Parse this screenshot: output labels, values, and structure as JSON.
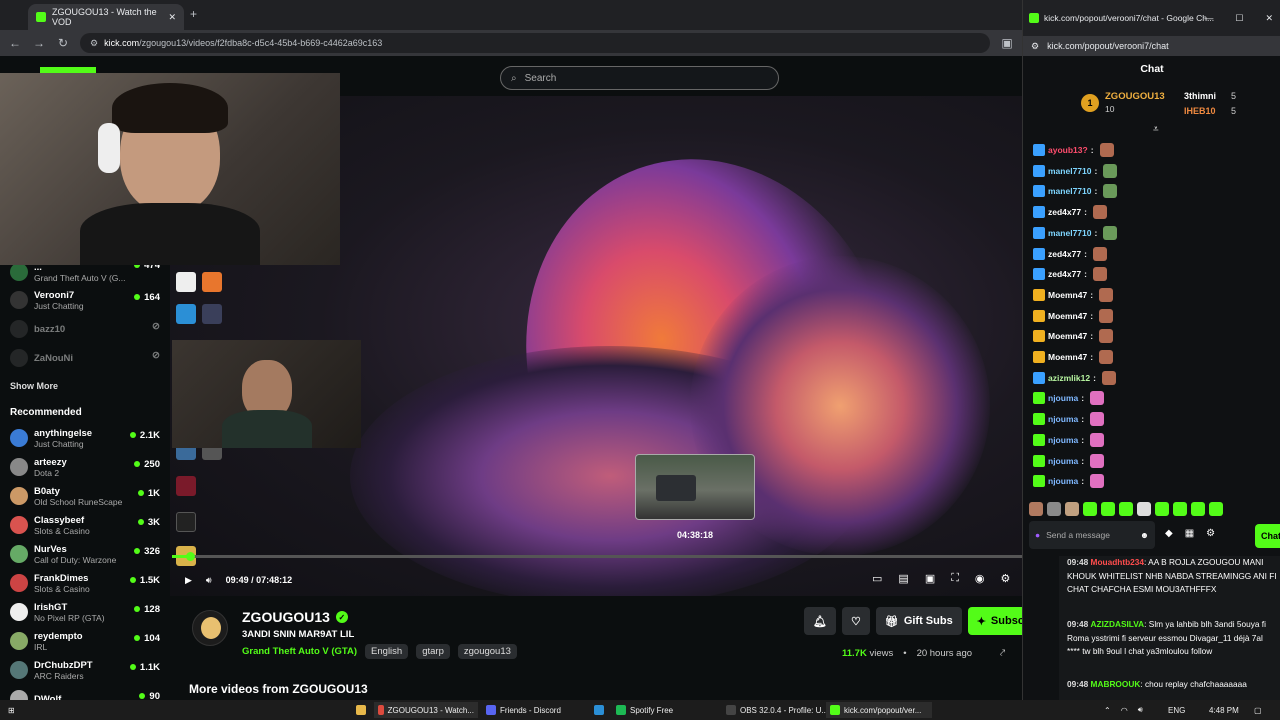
{
  "browser": {
    "tab_title": "ZGOUGOU13 - Watch the VOD",
    "new_tab": "+",
    "url_host": "kick.com",
    "url_path": "/zgougou13/videos/f2fdba8c-d5c4-45b4-b669-c4462a69c163"
  },
  "search": {
    "placeholder": "Search"
  },
  "sidebar": {
    "partial_top": {
      "name": "...",
      "game": "Grand Theft Auto V (G...",
      "count": "474"
    },
    "following": [
      {
        "name": "Verooni7",
        "game": "Just Chatting",
        "count": "164"
      },
      {
        "name": "bazz10",
        "game": "",
        "count": ""
      },
      {
        "name": "ZaNouNi",
        "game": "",
        "count": ""
      }
    ],
    "show_more": "Show More",
    "recommended_title": "Recommended",
    "recommended": [
      {
        "name": "anythingelse",
        "game": "Just Chatting",
        "count": "2.1K"
      },
      {
        "name": "arteezy",
        "game": "Dota 2",
        "count": "250"
      },
      {
        "name": "B0aty",
        "game": "Old School RuneScape",
        "count": "1K"
      },
      {
        "name": "Classybeef",
        "game": "Slots & Casino",
        "count": "3K"
      },
      {
        "name": "NurVes",
        "game": "Call of Duty: Warzone",
        "count": "326"
      },
      {
        "name": "FrankDimes",
        "game": "Slots & Casino",
        "count": "1.5K"
      },
      {
        "name": "IrishGT",
        "game": "No Pixel RP (GTA)",
        "count": "128"
      },
      {
        "name": "reydempto",
        "game": "IRL",
        "count": "104"
      },
      {
        "name": "DrChubzDPT",
        "game": "ARC Raiders",
        "count": "1.1K"
      },
      {
        "name": "DWolf",
        "game": "",
        "count": "90"
      }
    ]
  },
  "player": {
    "time_current": "09:49",
    "time_total": "07:48:12",
    "time_sep": " / ",
    "progress": 0.021,
    "hover_time": "04:38:18"
  },
  "channel": {
    "name": "ZGOUGOU13",
    "title": "3ANDI SNIN MAR9AT LIL",
    "category": "Grand Theft Auto V (GTA)",
    "tags": [
      "English",
      "gtarp",
      "zgougou13"
    ],
    "gift_label": "Gift Subs",
    "subscribe_label": "Subscribe",
    "views": "11.7K",
    "views_label": "views",
    "age": "20 hours ago",
    "more_videos": "More videos from ZGOUGOU13"
  },
  "chat": {
    "window_title": "kick.com/popout/verooni7/chat - Google Ch...",
    "url": "kick.com/popout/verooni7/chat",
    "header": "Chat",
    "leaderboard": {
      "first_name": "ZGOUGOU13",
      "first_value": "10",
      "second_name": "3thimni",
      "second_value": "5",
      "third_name": "IHEB10",
      "third_value": "5"
    },
    "messages": [
      {
        "user": "ayoub13?",
        "color": "#ff4d6d"
      },
      {
        "user": "manel7710",
        "color": "#7fd6ff"
      },
      {
        "user": "manel7710",
        "color": "#7fd6ff"
      },
      {
        "user": "zed4x77",
        "color": "#ffffff"
      },
      {
        "user": "manel7710",
        "color": "#7fd6ff"
      },
      {
        "user": "zed4x77",
        "color": "#ffffff"
      },
      {
        "user": "zed4x77",
        "color": "#ffffff"
      },
      {
        "user": "Moemn47",
        "color": "#ffffff"
      },
      {
        "user": "Moemn47",
        "color": "#ffffff"
      },
      {
        "user": "Moemn47",
        "color": "#ffffff"
      },
      {
        "user": "Moemn47",
        "color": "#ffffff"
      },
      {
        "user": "azizmlik12",
        "color": "#b7f5a0"
      },
      {
        "user": "njouma",
        "color": "#7fb8ff"
      },
      {
        "user": "njouma",
        "color": "#7fb8ff"
      },
      {
        "user": "njouma",
        "color": "#7fb8ff"
      },
      {
        "user": "njouma",
        "color": "#7fb8ff"
      },
      {
        "user": "njouma",
        "color": "#7fb8ff"
      }
    ],
    "input_placeholder": "Send a message",
    "send_label": "Chat"
  },
  "obs_chat": [
    {
      "time": "09:48",
      "user": "Mouadhtb234",
      "text": ": AA B ROJLA ZGOUGOU MANI KHOUK WHITELIST NHB NABDA STREAMINGG ANI FI CHAT CHAFCHA ESMI MOU3ATHFFFX"
    },
    {
      "time": "09:48",
      "user": "AZIZDASILVA",
      "text": ": Slm ya lahbib blh 3andi 5ouya fi Roma ysstrimi fi serveur essmou Divagar_11 déjà 7al **** tw blh 9oul l chat ya3mloulou follow"
    },
    {
      "time": "09:48",
      "user": "MABROOUK",
      "text": ": chou replay chafchaaaaaaa"
    }
  ],
  "taskbar": {
    "items": [
      "ZGOUGOU13 - Watch...",
      "Friends - Discord",
      "Spotify Free",
      "OBS 32.0.4 - Profile: U...",
      "kick.com/popout/ver..."
    ],
    "lang": "ENG",
    "time": "4:48 PM"
  }
}
